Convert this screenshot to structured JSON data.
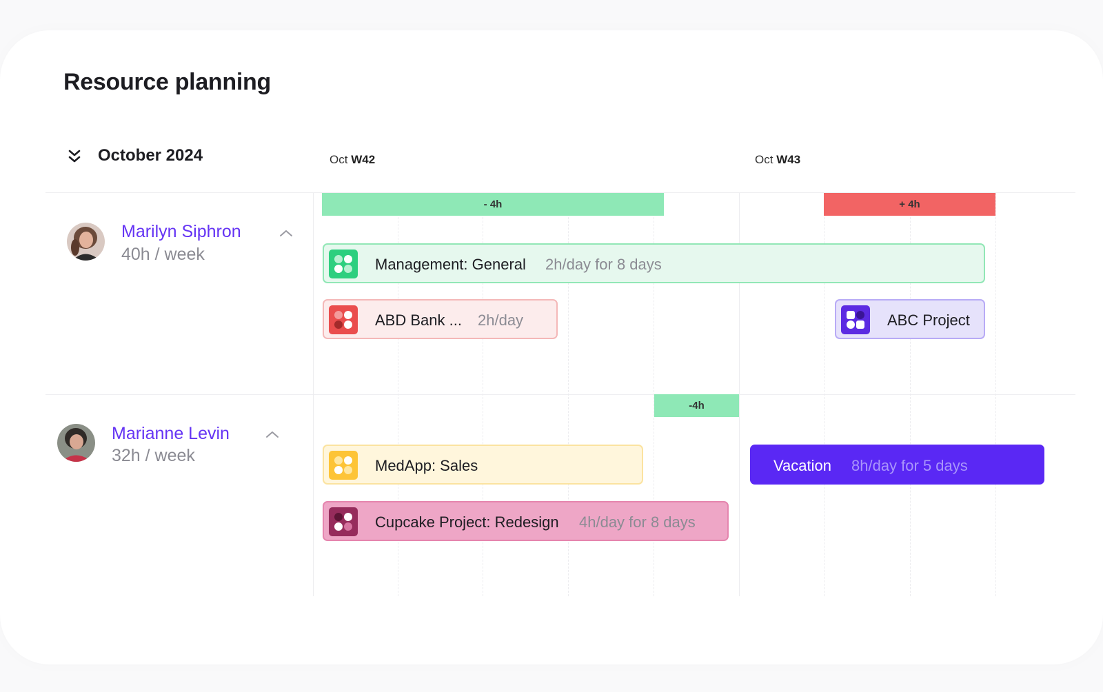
{
  "page": {
    "title": "Resource planning"
  },
  "calendar": {
    "month_label": "October 2024",
    "weeks": [
      {
        "month": "Oct",
        "week": "W42"
      },
      {
        "month": "Oct",
        "week": "W43"
      }
    ]
  },
  "people": [
    {
      "name": "Marilyn Siphron",
      "hours": "40h / week",
      "capacity": [
        {
          "label": "- 4h",
          "status": "under",
          "color": "#8ee8b6"
        },
        {
          "label": "+ 4h",
          "status": "over",
          "color": "#f26464"
        }
      ],
      "tasks": [
        {
          "name": "Management: General",
          "detail": "2h/day for 8 days",
          "icon": "grid-circles-icon",
          "bg": "#e6f8ee",
          "border": "#92e7b6",
          "icon_color": "#2dcf7f"
        },
        {
          "name": "ABD Bank ...",
          "detail": "2h/day",
          "icon": "grid-circles-icon",
          "bg": "#fcecec",
          "border": "#f4b8b8",
          "icon_color": "#ea4d4d"
        },
        {
          "name": "ABC Project",
          "detail": "",
          "icon": "grid-squares-icon",
          "bg": "#e6e2fb",
          "border": "#b8abf6",
          "icon_color": "#5c2be2"
        }
      ]
    },
    {
      "name": "Marianne Levin",
      "hours": "32h / week",
      "capacity": [
        {
          "label": "-4h",
          "status": "under",
          "color": "#8ee8b6"
        }
      ],
      "tasks": [
        {
          "name": "MedApp: Sales",
          "detail": "",
          "icon": "grid-circles-icon",
          "bg": "#fff6dc",
          "border": "#fbe3a0",
          "icon_color": "#fdc437"
        },
        {
          "name": "Cupcake Project: Redesign",
          "detail": "4h/day for 8 days",
          "icon": "grid-circles-icon",
          "bg": "#eea6c6",
          "border": "#e585ae",
          "icon_color": "#962c5c"
        },
        {
          "name": "Vacation",
          "detail": "8h/day for 5 days",
          "icon": "",
          "bg": "#5a28f4",
          "border": "#5a28f4",
          "icon_color": ""
        }
      ]
    }
  ]
}
